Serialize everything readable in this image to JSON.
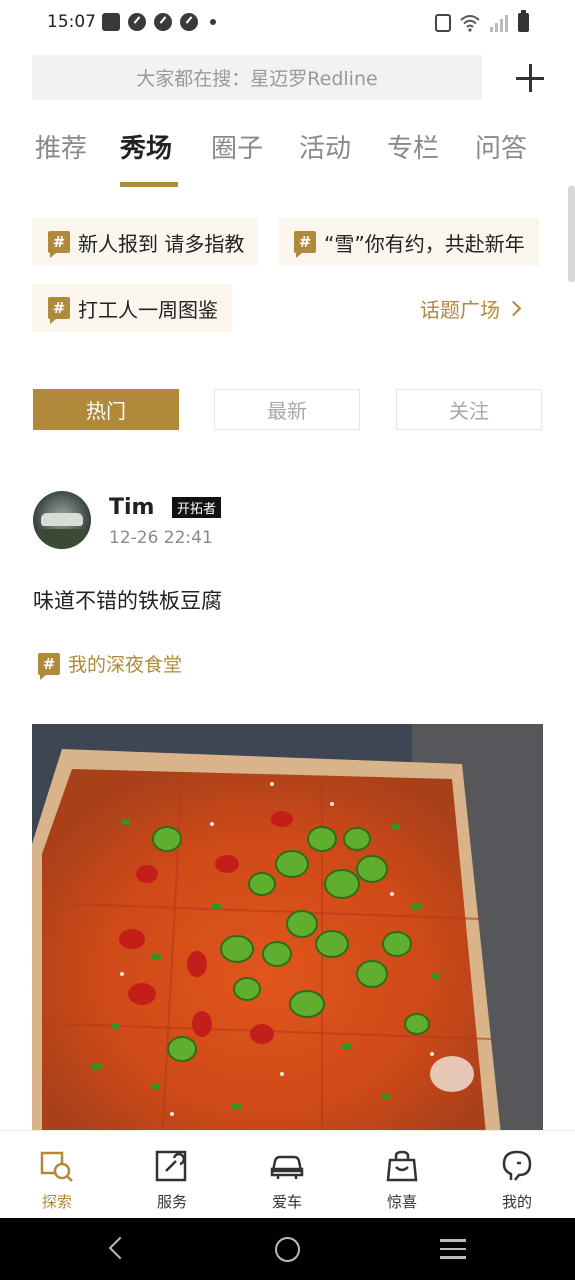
{
  "status_bar": {
    "time": "15:07"
  },
  "search": {
    "placeholder": "大家都在搜：星迈罗Redline"
  },
  "tabs": [
    {
      "label": "推荐",
      "active": false
    },
    {
      "label": "秀场",
      "active": true
    },
    {
      "label": "圈子",
      "active": false
    },
    {
      "label": "活动",
      "active": false
    },
    {
      "label": "专栏",
      "active": false
    },
    {
      "label": "问答",
      "active": false
    }
  ],
  "topics": {
    "hash_symbol": "#",
    "chips": [
      "新人报到 请多指教",
      "“雪”你有约，共赴新年",
      "打工人一周图鉴"
    ],
    "square_link": "话题广场"
  },
  "filters": [
    {
      "label": "热门",
      "active": true
    },
    {
      "label": "最新",
      "active": false
    },
    {
      "label": "关注",
      "active": false
    }
  ],
  "post": {
    "username": "Tim",
    "badge": "开拓者",
    "timestamp": "12-26 22:41",
    "text": "味道不错的铁板豆腐",
    "topic": "我的深夜食堂"
  },
  "bottom_nav": [
    {
      "label": "探索",
      "icon": "explore-icon",
      "active": true
    },
    {
      "label": "服务",
      "icon": "service-icon",
      "active": false
    },
    {
      "label": "爱车",
      "icon": "car-icon",
      "active": false
    },
    {
      "label": "惊喜",
      "icon": "shopping-bag-icon",
      "active": false
    },
    {
      "label": "我的",
      "icon": "profile-icon",
      "active": false
    }
  ],
  "colors": {
    "accent": "#b08a3a",
    "chip_bg": "#faf6ee"
  }
}
